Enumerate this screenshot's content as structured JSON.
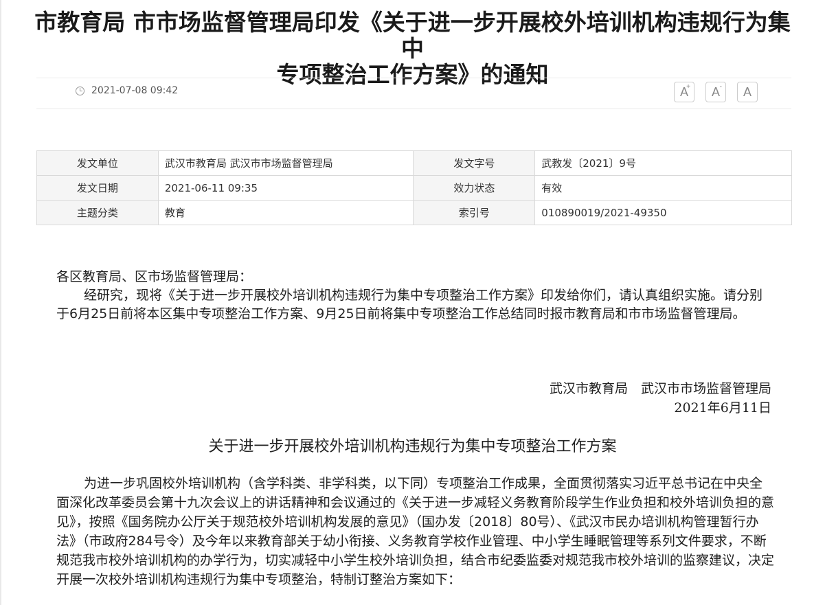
{
  "article": {
    "title_line1": "市教育局 市市场监督管理局印发《关于进一步开展校外培训机构违规行为集中",
    "title_line2": "专项整治工作方案》的通知",
    "publish_time": "2021-07-08 09:42",
    "clock_icon": "clock-icon"
  },
  "font_controls": {
    "increase": "A",
    "decrease": "A",
    "reset": "A",
    "plus_mark": "+",
    "minus_mark": "-"
  },
  "info_table": {
    "rows": [
      {
        "label1": "发文单位",
        "value1": "武汉市教育局 武汉市市场监督管理局",
        "label2": "发文字号",
        "value2": "武教发〔2021〕9号"
      },
      {
        "label1": "发文日期",
        "value1": "2021-06-11 09:35",
        "label2": "效力状态",
        "value2": "有效"
      },
      {
        "label1": "主题分类",
        "value1": "教育",
        "label2": "索引号",
        "value2": "010890019/2021-49350"
      }
    ]
  },
  "notice": {
    "salutation": "各区教育局、区市场监督管理局：",
    "paragraph": "经研究，现将《关于进一步开展校外培训机构违规行为集中专项整治工作方案》印发给你们，请认真组织实施。请分别于6月25日前将本区集中专项整治工作方案、9月25日前将集中专项整治工作总结同时报市教育局和市市场监督管理局。",
    "signer": "武汉市教育局　武汉市市场监督管理局",
    "sign_date": "2021年6月11日"
  },
  "plan": {
    "title": "关于进一步开展校外培训机构违规行为集中专项整治工作方案",
    "intro": "为进一步巩固校外培训机构（含学科类、非学科类，以下同）专项整治工作成果，全面贯彻落实习近平总书记在中央全面深化改革委员会第十九次会议上的讲话精神和会议通过的《关于进一步减轻义务教育阶段学生作业负担和校外培训负担的意见》，按照《国务院办公厅关于规范校外培训机构发展的意见》（国办发〔2018〕80号）、《武汉市民办培训机构管理暂行办法》（市政府284号令）及今年以来教育部关于幼小衔接、义务教育学校作业管理、中小学生睡眠管理等系列文件要求，不断规范我市校外培训机构的办学行为，切实减轻中小学生校外培训负担，结合市纪委监委对规范我市校外培训的监察建议，决定开展一次校外培训机构违规行为集中专项整治，特制订整治方案如下："
  }
}
